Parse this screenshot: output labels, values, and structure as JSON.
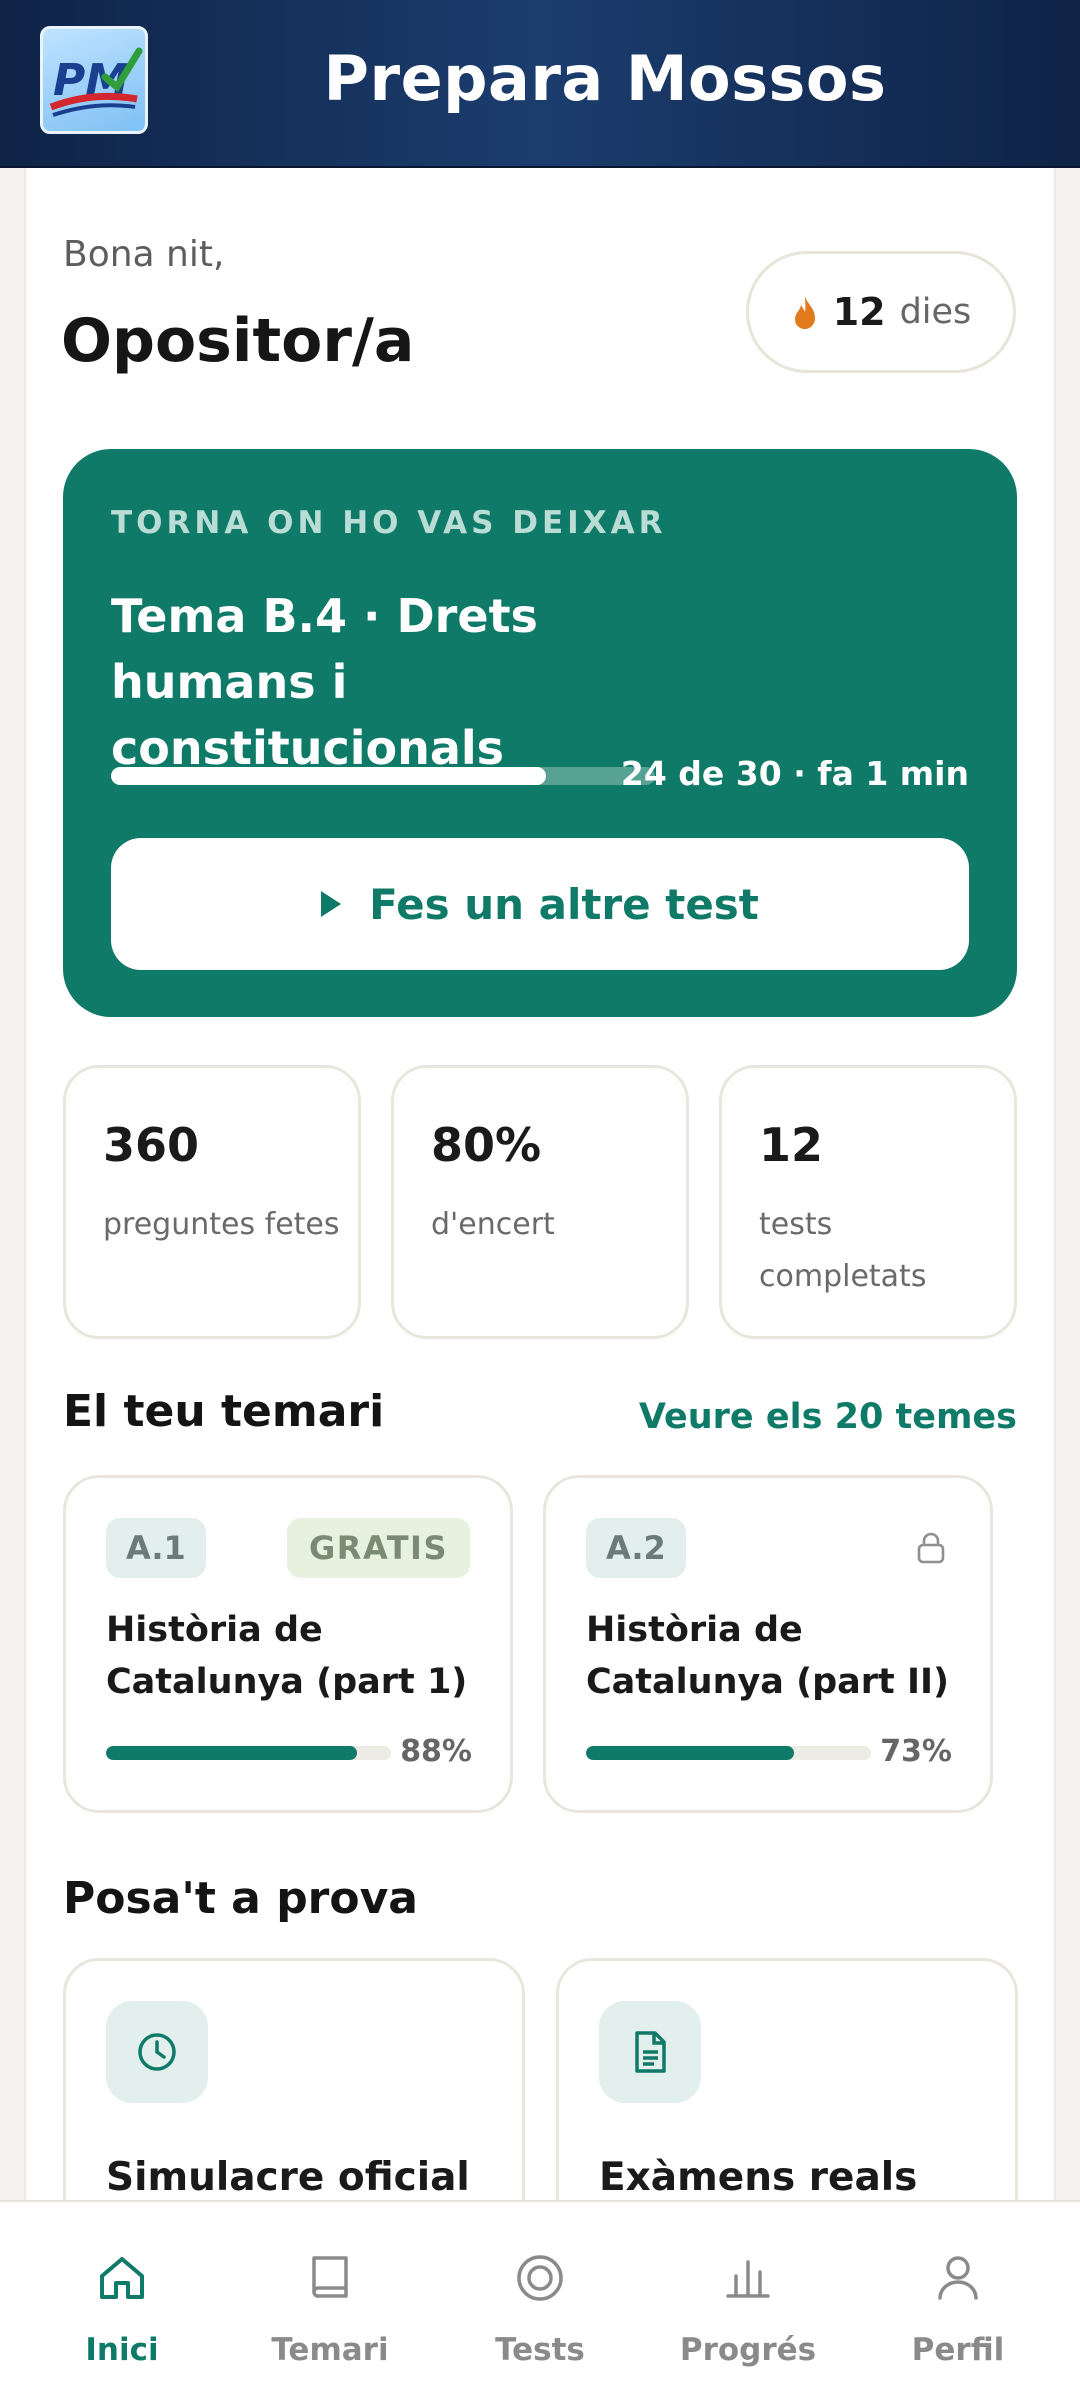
{
  "header": {
    "title": "Prepara Mossos",
    "logo_text": "PM"
  },
  "greeting": {
    "salutation": "Bona nit,",
    "name": "Opositor/a"
  },
  "streak": {
    "value": "12",
    "unit": "dies",
    "icon": "flame-icon"
  },
  "resume": {
    "eyebrow": "TORNA ON HO VAS DEIXAR",
    "topic_title": "Tema B.4 · Drets humans i constitucionals",
    "progress_text": "24 de 30 · fa 1 min",
    "progress_fraction": 0.8,
    "button_label": "Fes un altre test"
  },
  "stats": [
    {
      "value": "360",
      "label": "preguntes fetes"
    },
    {
      "value": "80%",
      "label": "d'encert"
    },
    {
      "value": "12",
      "label": "tests completats"
    }
  ],
  "temari": {
    "title": "El teu temari",
    "see_all": "Veure els 20 temes",
    "topics": [
      {
        "code": "A.1",
        "badge": "GRATIS",
        "title": "Història de Catalunya (part 1)",
        "percent": "88%",
        "fraction": 0.88,
        "locked": false
      },
      {
        "code": "A.2",
        "badge": "",
        "title": "Història de Catalunya (part II)",
        "percent": "73%",
        "fraction": 0.73,
        "locked": true
      }
    ]
  },
  "practice": {
    "title": "Posa't a prova",
    "modes": [
      {
        "title": "Simulacre oficial",
        "icon": "clock-icon"
      },
      {
        "title": "Exàmens reals",
        "icon": "document-icon"
      }
    ]
  },
  "tabs": [
    {
      "label": "Inici",
      "icon": "home-icon",
      "active": true
    },
    {
      "label": "Temari",
      "icon": "book-icon",
      "active": false
    },
    {
      "label": "Tests",
      "icon": "target-icon",
      "active": false
    },
    {
      "label": "Progrés",
      "icon": "bar-chart-icon",
      "active": false
    },
    {
      "label": "Perfil",
      "icon": "user-icon",
      "active": false
    }
  ],
  "colors": {
    "brand_green": "#107a68",
    "header_navy": "#0f2347",
    "streak_flame": "#e07a1c"
  }
}
